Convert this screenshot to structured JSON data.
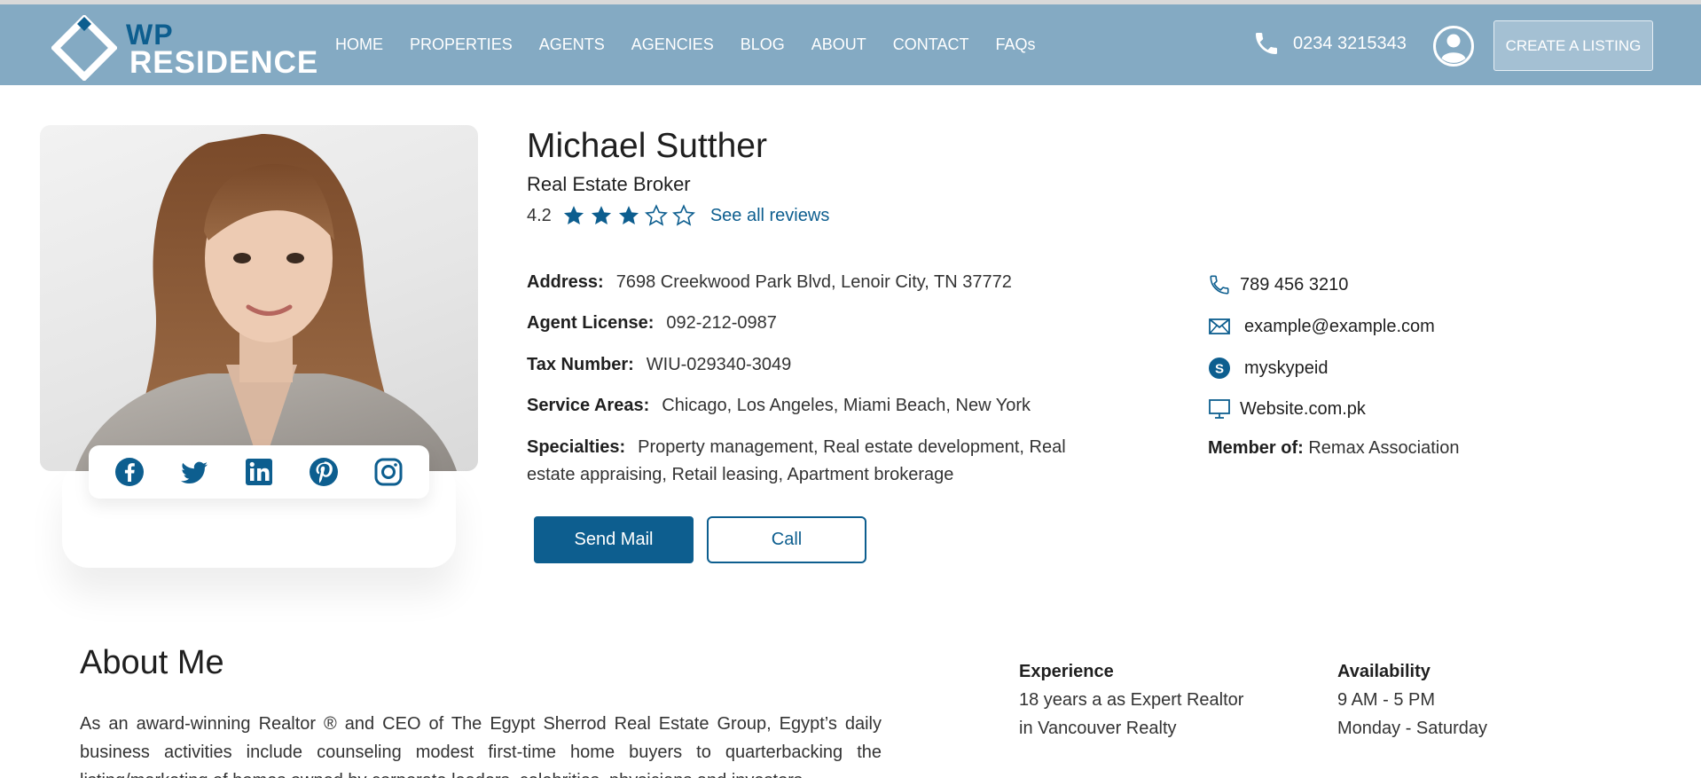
{
  "brand": {
    "logo_top": "WP",
    "logo_bottom": "RESIDENCE"
  },
  "nav": {
    "items": [
      {
        "label": "HOME"
      },
      {
        "label": "PROPERTIES"
      },
      {
        "label": "AGENTS"
      },
      {
        "label": "AGENCIES"
      },
      {
        "label": "BLOG"
      },
      {
        "label": "ABOUT"
      },
      {
        "label": "CONTACT"
      },
      {
        "label": "FAQs"
      }
    ],
    "phone": "0234 3215343",
    "cta": "CREATE A LISTING"
  },
  "agent": {
    "name": "Michael Sutther",
    "role": "Real Estate Broker",
    "rating": "4.2",
    "stars_filled": 3,
    "stars_total": 5,
    "reviews_link": "See all reviews",
    "details": {
      "address_label": "Address:",
      "address": "7698 Creekwood Park Blvd, Lenoir City, TN 37772",
      "license_label": "Agent License:",
      "license": "092-212-0987",
      "tax_label": "Tax Number:",
      "tax": "WIU-029340-3049",
      "areas_label": "Service Areas:",
      "areas": "Chicago, Los Angeles, Miami Beach, New York",
      "specialties_label": "Specialties:",
      "specialties": "Property management, Real estate development, Real estate appraising, Retail leasing, Apartment brokerage"
    },
    "contact": {
      "phone": "789 456 3210",
      "email": "example@example.com",
      "skype": "myskypeid",
      "website": "Website.com.pk",
      "member_label": "Member of:",
      "member": "Remax Association"
    },
    "buttons": {
      "send": "Send Mail",
      "call": "Call"
    },
    "social": [
      "facebook-icon",
      "twitter-icon",
      "linkedin-icon",
      "pinterest-icon",
      "instagram-icon"
    ]
  },
  "about": {
    "title": "About Me",
    "text": "As an award-winning Realtor ® and CEO of The Egypt Sherrod Real Estate Group, Egypt’s daily business activities include counseling modest first-time home buyers to quarterbacking the listing/marketing of homes owned by corporate leaders, celebrities, physicians and investors.",
    "experience_label": "Experience",
    "experience_line1": "18 years a as Expert Realtor",
    "experience_line2": "in Vancouver Realty",
    "availability_label": "Availability",
    "availability_hours": "9 AM - 5 PM",
    "availability_days": "Monday - Saturday"
  },
  "colors": {
    "header": "#84aac3",
    "accent": "#0d5e8f"
  }
}
